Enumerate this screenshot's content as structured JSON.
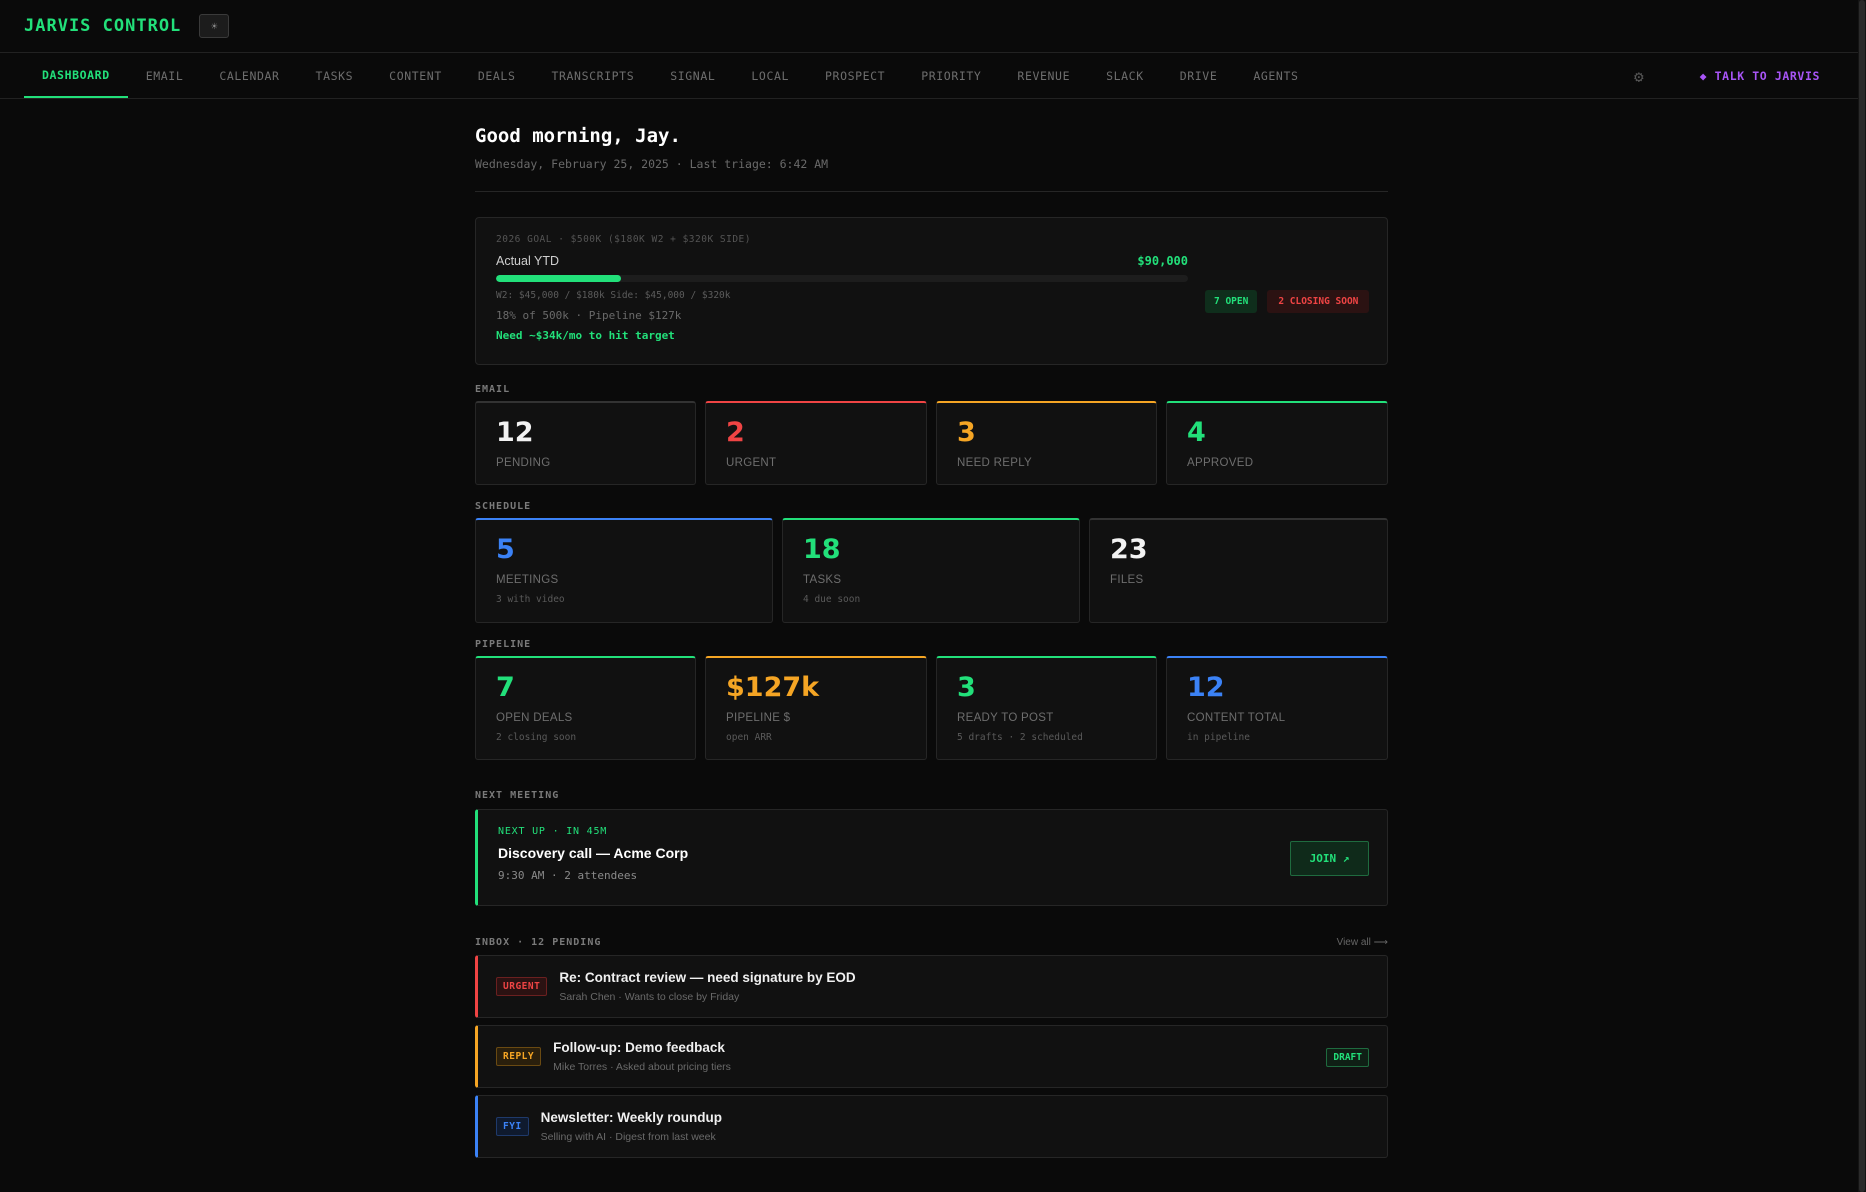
{
  "app": {
    "title": "JARVIS CONTROL",
    "theme_icon": "sun-icon",
    "theme_glyph": "☀"
  },
  "nav": {
    "tabs": [
      "DASHBOARD",
      "EMAIL",
      "CALENDAR",
      "TASKS",
      "CONTENT",
      "DEALS",
      "TRANSCRIPTS",
      "SIGNAL",
      "LOCAL",
      "PROSPECT",
      "PRIORITY",
      "REVENUE",
      "SLACK",
      "DRIVE",
      "AGENTS"
    ],
    "active": "DASHBOARD",
    "settings_glyph": "⚙",
    "talk_label": "◆ TALK TO JARVIS"
  },
  "header": {
    "greeting": "Good morning, Jay.",
    "subline": "Wednesday, February 25, 2025 · Last triage: 6:42 AM"
  },
  "goal": {
    "caption": "2026 GOAL · $500K ($180K W2 + $320K SIDE)",
    "label": "Actual YTD",
    "amount": "$90,000",
    "progress": 0.18,
    "breakdown": "W2: $45,000 / $180k  Side: $45,000 / $320k",
    "summary": "18% of 500k · Pipeline $127k",
    "need": "Need ~$34k/mo to hit target",
    "badge_open": "7 OPEN",
    "badge_closing": "2 CLOSING SOON"
  },
  "email": {
    "label": "EMAIL",
    "cards": [
      {
        "value": "12",
        "label": "PENDING"
      },
      {
        "value": "2",
        "label": "URGENT"
      },
      {
        "value": "3",
        "label": "NEED REPLY"
      },
      {
        "value": "4",
        "label": "APPROVED"
      }
    ]
  },
  "schedule": {
    "label": "SCHEDULE",
    "cards": [
      {
        "value": "5",
        "label": "MEETINGS",
        "sub": "3 with video"
      },
      {
        "value": "18",
        "label": "TASKS",
        "sub": "4 due soon"
      },
      {
        "value": "23",
        "label": "FILES",
        "sub": ""
      }
    ]
  },
  "pipeline": {
    "label": "PIPELINE",
    "cards": [
      {
        "value": "7",
        "label": "OPEN DEALS",
        "sub": "2 closing soon"
      },
      {
        "value": "$127k",
        "label": "PIPELINE $",
        "sub": "open ARR"
      },
      {
        "value": "3",
        "label": "READY TO POST",
        "sub": "5 drafts · 2 scheduled"
      },
      {
        "value": "12",
        "label": "CONTENT TOTAL",
        "sub": "in pipeline"
      }
    ]
  },
  "next_meeting": {
    "label": "NEXT MEETING",
    "tag": "NEXT UP · IN 45M",
    "title": "Discovery call — Acme Corp",
    "sub": "9:30 AM · 2 attendees",
    "join_label": "JOIN ↗"
  },
  "inbox": {
    "label": "INBOX · 12 PENDING",
    "view_all": "View all ⟶",
    "items": [
      {
        "tag": "URGENT",
        "title": "Re: Contract review — need signature by EOD",
        "sub": "Sarah Chen · Wants to close by Friday",
        "action": ""
      },
      {
        "tag": "REPLY",
        "title": "Follow-up: Demo feedback",
        "sub": "Mike Torres · Asked about pricing tiers",
        "action": "DRAFT"
      },
      {
        "tag": "FYI",
        "title": "Newsletter: Weekly roundup",
        "sub": "Selling with AI · Digest from last week",
        "action": ""
      }
    ]
  },
  "colors": {
    "accent": "#22e07a",
    "urgent": "#ef4444",
    "warn": "#f5a524",
    "info": "#3b82f6",
    "talk": "#a855f7"
  }
}
